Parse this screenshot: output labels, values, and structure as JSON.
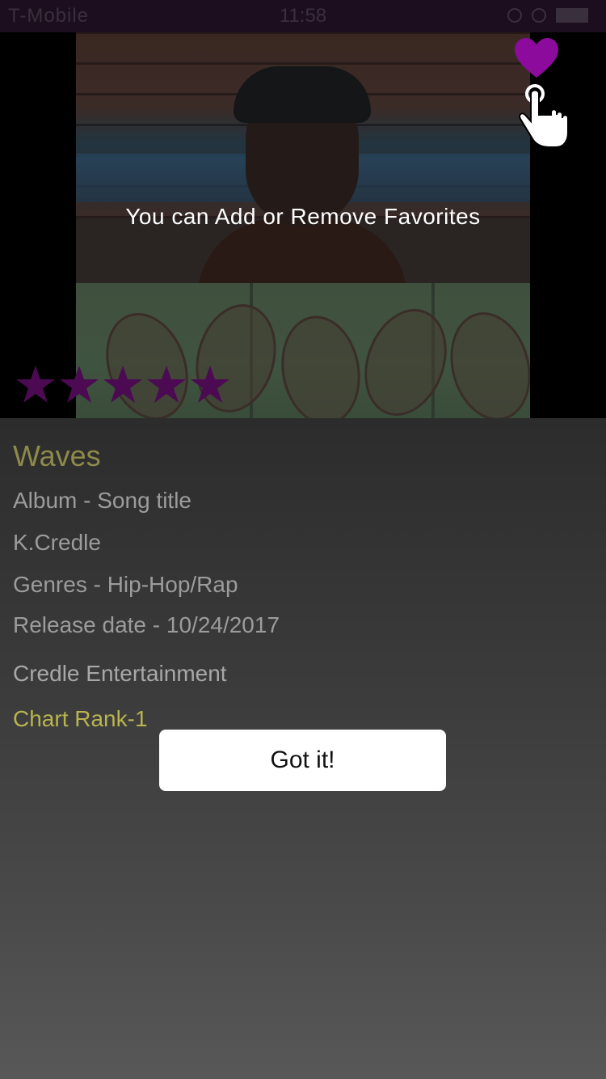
{
  "status_bar": {
    "carrier": "T-Mobile",
    "time": "11:58"
  },
  "hero": {
    "hint": "You can Add or Remove Favorites",
    "heart_color": "#8c0a9c",
    "rating": {
      "value": 5,
      "max": 5,
      "star_color": "#4b0a52"
    }
  },
  "song": {
    "title": "Waves",
    "album": "Album - Song title",
    "artist": "K.Credle",
    "genres": "Genres - Hip-Hop/Rap",
    "release": "Release date - 10/24/2017",
    "label": "Credle Entertainment",
    "chart_rank": "Chart Rank-1"
  },
  "dialog": {
    "button_label": "Got it!"
  }
}
